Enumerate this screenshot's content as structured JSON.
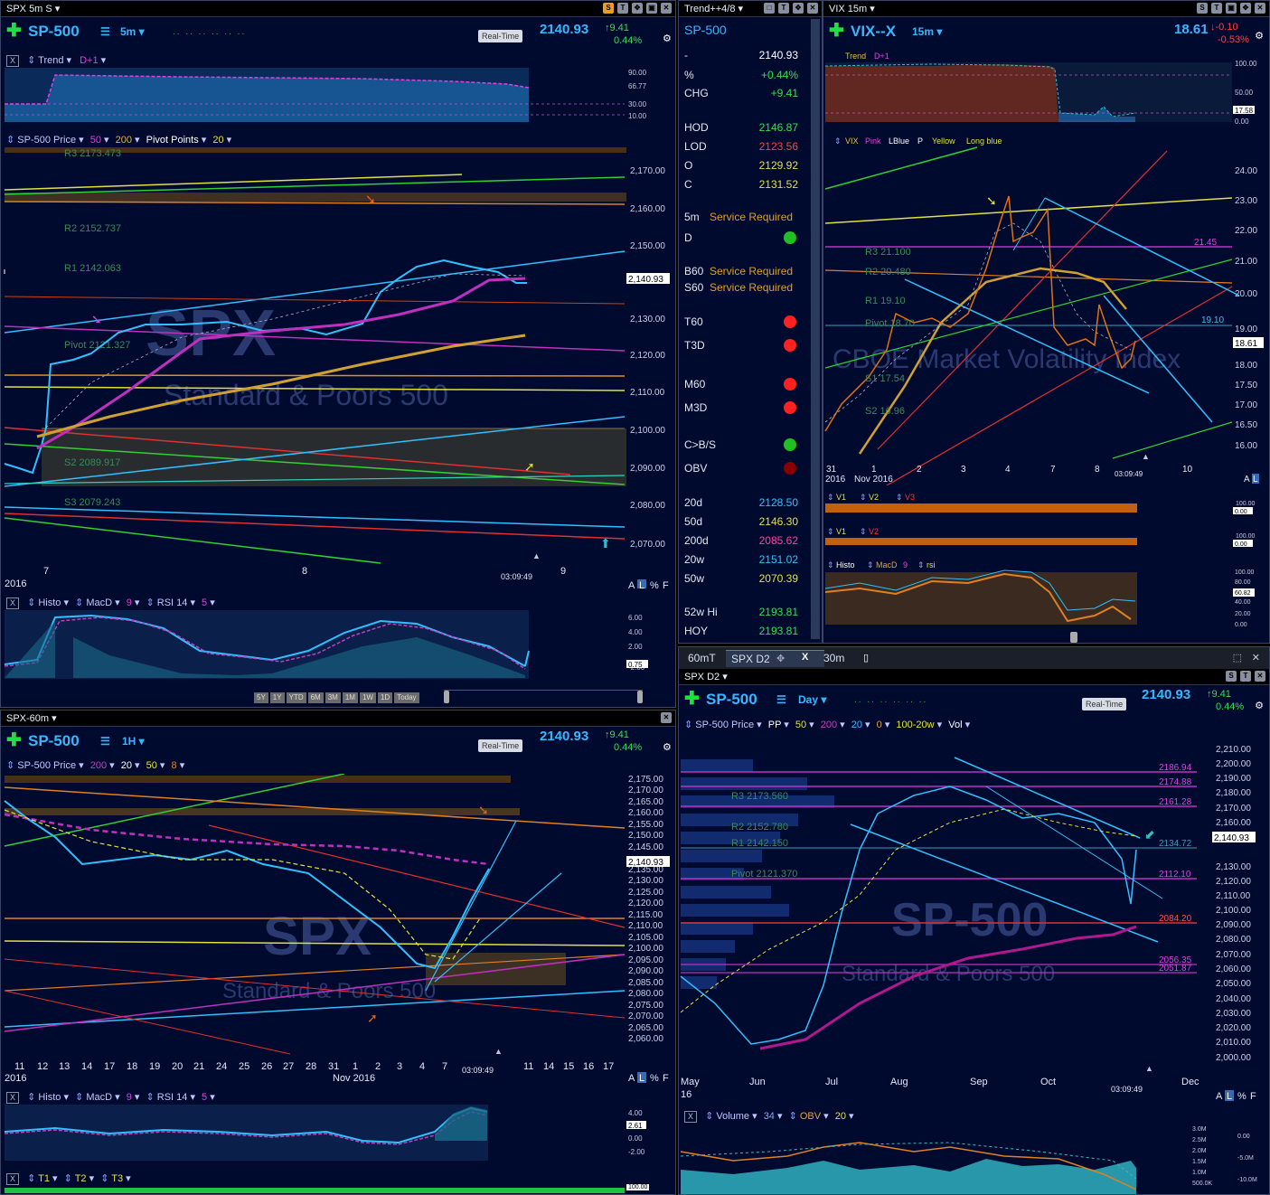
{
  "panel_tl": {
    "window_title": "SPX 5m S",
    "symbol": "SP-500",
    "timeframe": "5m",
    "realtime_label": "Real-Time",
    "price": "2140.93",
    "change": "9.41",
    "change_pct": "0.44%",
    "trend_strip": {
      "label": "Trend",
      "param": "D+1"
    },
    "trend_axis": [
      "90.00",
      "66.77",
      "30.00",
      "10.00"
    ],
    "price_strip": {
      "label": "SP-500 Price",
      "p1": "50",
      "p2": "200",
      "p3": "Pivot Points",
      "p4": "20"
    },
    "pivots": [
      "R3 2173.473",
      "R2 2152.737",
      "R1 2142.063",
      "Pivot 2121.327",
      "S2 2089.917",
      "S3 2079.243"
    ],
    "y_axis": [
      "2,170.00",
      "2,160.00",
      "2,150.00",
      "2,130.00",
      "2,120.00",
      "2,110.00",
      "2,100.00",
      "2,090.00",
      "2,080.00",
      "2,070.00"
    ],
    "last_price_tag": "2,140.93",
    "x_axis": [
      "7",
      "8",
      "9"
    ],
    "year": "2016",
    "clock": "03:09:49",
    "watermark1": "SPX",
    "watermark2": "Standard & Poors 500",
    "axis_mode": [
      "A",
      "L",
      "%",
      "F"
    ],
    "macd_strip": {
      "l1": "Histo",
      "l2": "MacD",
      "p1": "9",
      "l3": "RSI 14",
      "p2": "5"
    },
    "macd_axis": [
      "6.00",
      "4.00",
      "2.00",
      "0.75",
      "-2.00"
    ],
    "range_buttons": [
      "5Y",
      "1Y",
      "YTD",
      "6M",
      "3M",
      "1M",
      "1W",
      "1D",
      "Today"
    ]
  },
  "panel_trend": {
    "window_title": "Trend++4/8",
    "symbol": "SP-500",
    "rows": [
      {
        "label": "-",
        "value": "2140.93",
        "color": "#ffffff"
      },
      {
        "label": "%",
        "value": "+0.44%",
        "color": "#30e050"
      },
      {
        "label": "CHG",
        "value": "+9.41",
        "color": "#30e050"
      },
      {
        "label": "HOD",
        "value": "2146.87",
        "color": "#30e050"
      },
      {
        "label": "LOD",
        "value": "2123.56",
        "color": "#ff4040"
      },
      {
        "label": "O",
        "value": "2129.92",
        "color": "#e0e040"
      },
      {
        "label": "C",
        "value": "2131.52",
        "color": "#e0e040"
      },
      {
        "label": "5m",
        "value": "Service Required",
        "color": "#e0a020"
      },
      {
        "label": "D",
        "dot": "#20c020"
      },
      {
        "label": "B60",
        "value": "Service Required",
        "color": "#e0a020"
      },
      {
        "label": "S60",
        "value": "Service Required",
        "color": "#e0a020"
      },
      {
        "label": "T60",
        "dot": "#ff2020"
      },
      {
        "label": "T3D",
        "dot": "#ff2020"
      },
      {
        "label": "M60",
        "dot": "#ff2020"
      },
      {
        "label": "M3D",
        "dot": "#ff2020"
      },
      {
        "label": "C>B/S",
        "dot": "#20c020"
      },
      {
        "label": "OBV",
        "dot": "#8a0000"
      },
      {
        "label": "20d",
        "value": "2128.50",
        "color": "#30c0ff"
      },
      {
        "label": "50d",
        "value": "2146.30",
        "color": "#e0e040"
      },
      {
        "label": "200d",
        "value": "2085.62",
        "color": "#ff40a0"
      },
      {
        "label": "20w",
        "value": "2151.02",
        "color": "#30c0ff"
      },
      {
        "label": "50w",
        "value": "2070.39",
        "color": "#e0e040"
      },
      {
        "label": "52w Hi",
        "value": "2193.81",
        "color": "#30e050"
      },
      {
        "label": "HOY",
        "value": "2193.81",
        "color": "#30e050"
      }
    ]
  },
  "panel_vix": {
    "window_title": "VIX 15m",
    "symbol": "VIX--X",
    "timeframe": "15m",
    "price": "18.61",
    "change": "-0.10",
    "change_pct": "-0.53%",
    "trend_strip": {
      "label": "Trend",
      "param": "D+1"
    },
    "trend_axis": [
      "100.00",
      "50.00",
      "17.58",
      "0.00"
    ],
    "legend": [
      "VIX",
      "Pink",
      "LBlue",
      "P",
      "Yellow",
      "Long blue"
    ],
    "pivots": [
      "R3 21.100",
      "R2 20.480",
      "R1 19.10",
      "Pivot 18.70",
      "S1 17.54",
      "S2 16.96"
    ],
    "levels": [
      "21.45",
      "19.10"
    ],
    "y_axis": [
      "24.00",
      "23.00",
      "22.00",
      "21.00",
      "20.00",
      "19.00",
      "18.00",
      "17.50",
      "17.00",
      "16.50",
      "16.00"
    ],
    "last_price_tag": "18.61",
    "x_axis": [
      "31",
      "1",
      "2",
      "3",
      "4",
      "7",
      "8",
      "10"
    ],
    "x_sub": [
      "2016",
      "Nov 2016"
    ],
    "clock": "03:09:49",
    "watermark": "CBOE Market Volatility Index",
    "v_strip1": [
      "V1",
      "V2",
      "V3"
    ],
    "v_strip2": [
      "V1",
      "V2"
    ],
    "v_axis": [
      "100.00",
      "0.00"
    ],
    "macd_strip": {
      "l1": "Histo",
      "l2": "MacD",
      "p1": "9",
      "l3": "rsi"
    },
    "macd_axis": [
      "100.00",
      "80.00",
      "60.82",
      "40.00",
      "20.00",
      "0.00"
    ],
    "axis_mode": [
      "A",
      "L",
      "%",
      "F"
    ]
  },
  "panel_bl": {
    "window_title": "SPX-60m",
    "symbol": "SP-500",
    "timeframe": "1H",
    "realtime_label": "Real-Time",
    "price": "2140.93",
    "change": "9.41",
    "change_pct": "0.44%",
    "price_strip": {
      "label": "SP-500 Price",
      "p1": "200",
      "p2": "20",
      "p3": "50",
      "p4": "8"
    },
    "y_axis": [
      "2,175.00",
      "2,170.00",
      "2,165.00",
      "2,160.00",
      "2,155.00",
      "2,150.00",
      "2,145.00",
      "2,135.00",
      "2,130.00",
      "2,125.00",
      "2,120.00",
      "2,115.00",
      "2,110.00",
      "2,105.00",
      "2,100.00",
      "2,095.00",
      "2,090.00",
      "2,085.00",
      "2,080.00",
      "2,075.00",
      "2,070.00",
      "2,065.00",
      "2,060.00"
    ],
    "last_price_tag": "2,140.93",
    "x_axis": [
      "11",
      "12",
      "13",
      "14",
      "17",
      "18",
      "19",
      "20",
      "21",
      "24",
      "25",
      "26",
      "27",
      "28",
      "31",
      "1",
      "2",
      "3",
      "4",
      "7",
      "11",
      "14",
      "15",
      "16",
      "17"
    ],
    "x_sub": [
      "2016",
      "Nov 2016"
    ],
    "clock": "03:09:49",
    "watermark1": "SPX",
    "watermark2": "Standard & Poors 500",
    "axis_mode": [
      "A",
      "L",
      "%",
      "F"
    ],
    "macd_strip": {
      "l1": "Histo",
      "l2": "MacD",
      "p1": "9",
      "l3": "RSI 14",
      "p2": "5"
    },
    "macd_axis": [
      "4.00",
      "2.61",
      "0.00",
      "-2.00"
    ],
    "t_strip": [
      "T1",
      "T2",
      "T3"
    ],
    "t_axis": "100.00"
  },
  "panel_br": {
    "tabs": [
      "60mT",
      "SPX D2",
      "30m"
    ],
    "window_title": "SPX D2",
    "symbol": "SP-500",
    "timeframe": "Day",
    "realtime_label": "Real-Time",
    "price": "2140.93",
    "change": "9.41",
    "change_pct": "0.44%",
    "price_strip": {
      "label": "SP-500 Price",
      "p0": "PP",
      "p1": "50",
      "p2": "200",
      "p3": "20",
      "p4": "0",
      "p5": "100-20w",
      "p6": "Vol"
    },
    "pivots": [
      "R3 2173.560",
      "R2 2152.780",
      "R1 2142.150",
      "Pivot 2121.370"
    ],
    "levels": [
      "2186.94",
      "2174.88",
      "2161.28",
      "2134.72",
      "2112.10",
      "2084.20",
      "2056.35",
      "2051.87"
    ],
    "y_axis": [
      "2,210.00",
      "2,200.00",
      "2,190.00",
      "2,180.00",
      "2,170.00",
      "2,160.00",
      "2,150.00",
      "2,130.00",
      "2,120.00",
      "2,110.00",
      "2,100.00",
      "2,090.00",
      "2,080.00",
      "2,070.00",
      "2,060.00",
      "2,050.00",
      "2,040.00",
      "2,030.00",
      "2,020.00",
      "2,010.00",
      "2,000.00"
    ],
    "last_price_tag": "2,140.93",
    "x_axis": [
      "May",
      "Jun",
      "Jul",
      "Aug",
      "Sep",
      "Oct",
      "Dec"
    ],
    "x_sub": "16",
    "clock": "03:09:49",
    "watermark": "SP-500",
    "watermark2": "Standard & Poors 500",
    "axis_mode": [
      "A",
      "L",
      "%",
      "F"
    ],
    "vol_strip": {
      "l1": "Volume",
      "p1": "34",
      "l2": "OBV",
      "p2": "20"
    },
    "vol_axis_left": [
      "3.0M",
      "2.5M",
      "2.0M",
      "1.5M",
      "1.0M",
      "500.0K"
    ],
    "vol_axis_right": [
      "0.00",
      "-5.0M",
      "-10.0M"
    ]
  }
}
